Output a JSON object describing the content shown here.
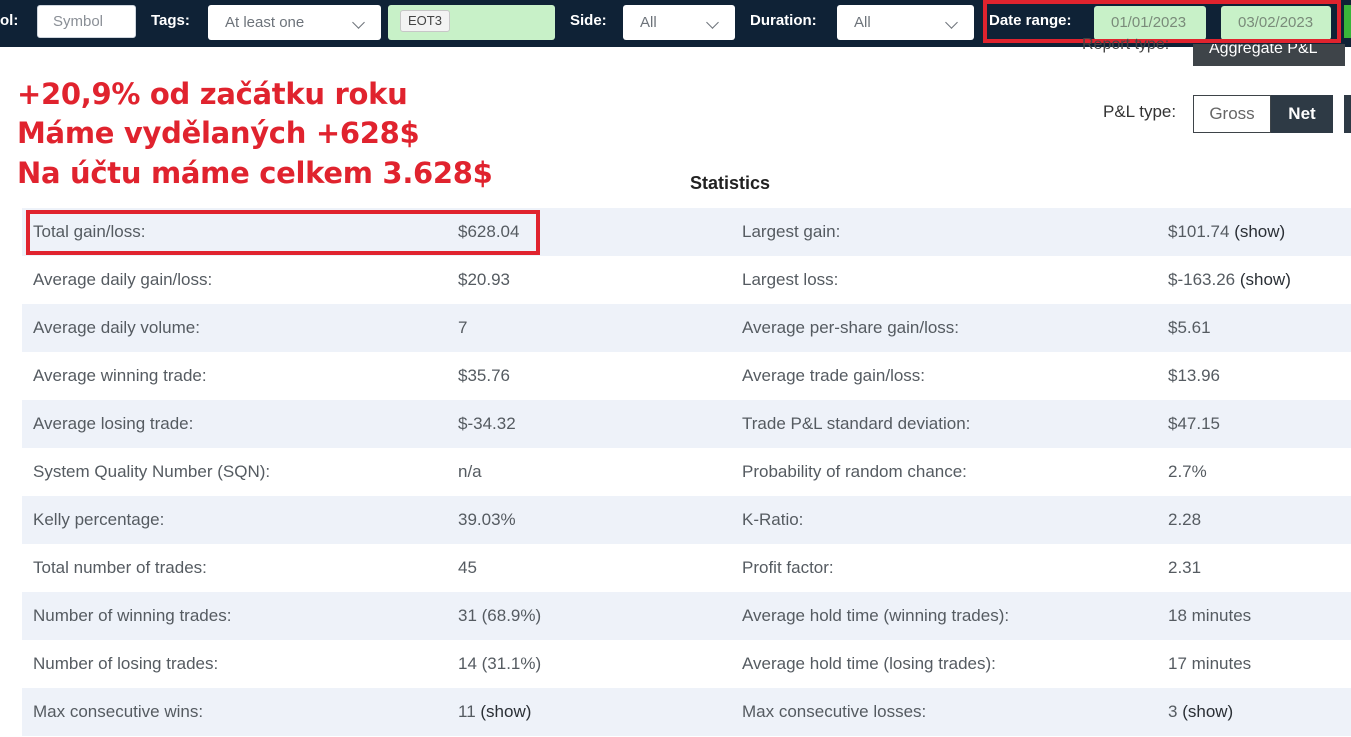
{
  "filters": {
    "symbol_label": "ol:",
    "symbol_placeholder": "Symbol",
    "tags_label": "Tags:",
    "tags_value": "At least one",
    "tag_chip": "EOT3",
    "side_label": "Side:",
    "side_value": "All",
    "duration_label": "Duration:",
    "duration_value": "All",
    "date_range_label": "Date range:",
    "date_from": "01/01/2023",
    "date_to": "03/02/2023"
  },
  "report": {
    "type_label": "Report type:",
    "type_value": "Aggregate P&L"
  },
  "pl_type": {
    "label": "P&L type:",
    "options": [
      "Gross",
      "Net"
    ],
    "selected": "Net"
  },
  "annotations": [
    "+20,9% od začátku roku",
    "Máme vydělaných +628$",
    "Na účtu máme celkem 3.628$"
  ],
  "statistics": {
    "title": "Statistics",
    "rows": [
      {
        "l1": "Total gain/loss:",
        "v1": "$628.04",
        "l2": "Largest gain:",
        "v2": "$101.74",
        "v2_link": "(show)"
      },
      {
        "l1": "Average daily gain/loss:",
        "v1": "$20.93",
        "l2": "Largest loss:",
        "v2": "$-163.26",
        "v2_link": "(show)"
      },
      {
        "l1": "Average daily volume:",
        "v1": "7",
        "l2": "Average per-share gain/loss:",
        "v2": "$5.61"
      },
      {
        "l1": "Average winning trade:",
        "v1": "$35.76",
        "l2": "Average trade gain/loss:",
        "v2": "$13.96"
      },
      {
        "l1": "Average losing trade:",
        "v1": "$-34.32",
        "l2": "Trade P&L standard deviation:",
        "v2": "$47.15"
      },
      {
        "l1": "System Quality Number (SQN):",
        "v1": "n/a",
        "l2": "Probability of random chance:",
        "v2": "2.7%"
      },
      {
        "l1": "Kelly percentage:",
        "v1": "39.03%",
        "l2": "K-Ratio:",
        "v2": "2.28"
      },
      {
        "l1": "Total number of trades:",
        "v1": "45",
        "l2": "Profit factor:",
        "v2": "2.31"
      },
      {
        "l1": "Number of winning trades:",
        "v1": "31 (68.9%)",
        "l2": "Average hold time (winning trades):",
        "v2": "18 minutes"
      },
      {
        "l1": "Number of losing trades:",
        "v1": "14 (31.1%)",
        "l2": "Average hold time (losing trades):",
        "v2": "17 minutes"
      },
      {
        "l1": "Max consecutive wins:",
        "v1": "11",
        "v1_link": "(show)",
        "l2": "Max consecutive losses:",
        "v2": "3",
        "v2_link": "(show)"
      }
    ]
  },
  "colors": {
    "topbar": "#0f2236",
    "highlight_red": "#e0232e",
    "date_green": "#c8f1c8",
    "row_stripe": "#eef2f9"
  }
}
